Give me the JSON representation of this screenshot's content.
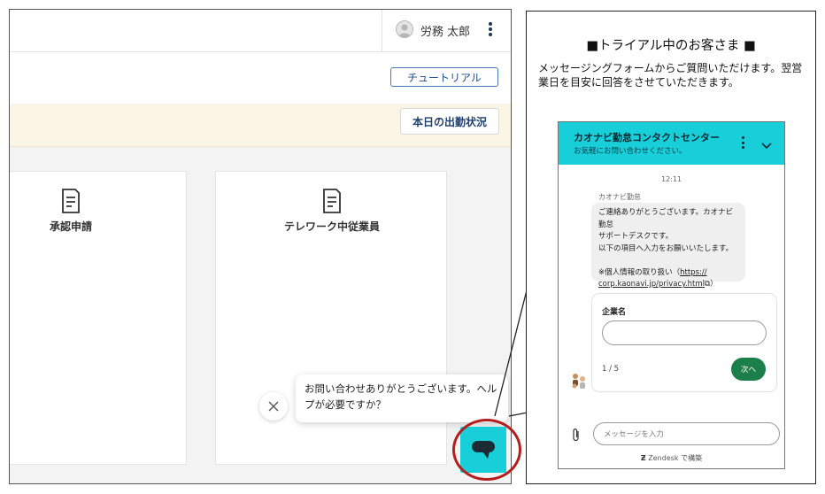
{
  "app": {
    "user_name": "労務 太郎",
    "tutorial_label": "チュートリアル",
    "attendance_label": "本日の出勤状況",
    "cards": [
      {
        "title": "承認申請",
        "icon": "document-icon"
      },
      {
        "title": "テレワーク中従業員",
        "icon": "document-icon"
      }
    ]
  },
  "chat_bubble": {
    "text": "お問い合わせありがとうございます。ヘルプが必要ですか？"
  },
  "callout": {
    "title": "■トライアル中のお客さま ■",
    "description": "メッセージングフォームからご質問いただけます。翌営業日を目安に回答をさせていただきます。"
  },
  "widget": {
    "title": "カオナビ勤怠コンタクトセンター",
    "subtitle": "お気軽にお問い合わせください。",
    "time": "12:11",
    "sender": "カオナビ勤怠",
    "message_lines": [
      "ご連絡ありがとうございます。カオナビ勤怠",
      "サポートデスクです。",
      "以下の項目へ入力をお願いいたします。",
      "",
      "※個人情報の取り扱い（"
    ],
    "privacy_link_1": "https://",
    "privacy_link_2": "corp.kaonavi.jp/privacy.html",
    "message_suffix": "）",
    "form_label": "企業名",
    "page_indicator": "1 / 5",
    "next_label": "次へ",
    "input_placeholder": "メッセージを入力",
    "footer": "Zendesk で構築"
  },
  "colors": {
    "accent_teal": "#17ced9",
    "next_green": "#1a7f48",
    "highlight_red": "#b41e1e",
    "notice_bg": "#fbf5e6"
  }
}
